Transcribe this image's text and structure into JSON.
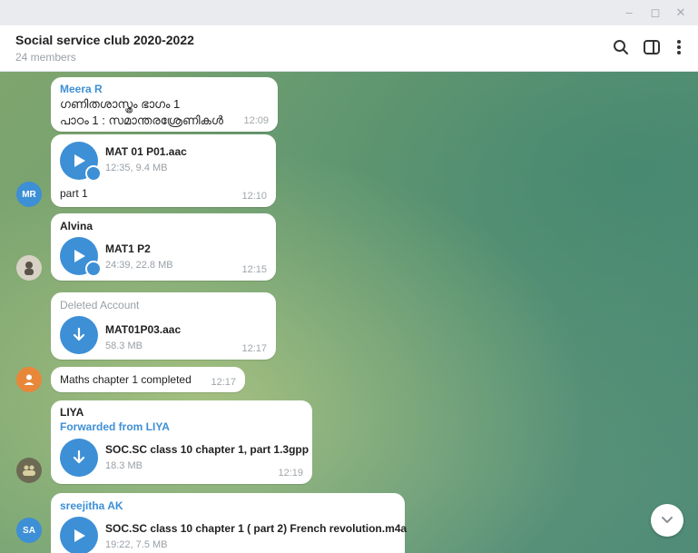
{
  "window": {
    "controls": [
      "–",
      "◻",
      "✕"
    ]
  },
  "header": {
    "title": "Social service club 2020-2022",
    "subtitle": "24 members",
    "icons": [
      "search-icon",
      "sidebar-toggle-icon",
      "more-vertical-icon"
    ]
  },
  "messages": [
    {
      "sender": "Meera R",
      "sender_color": "#3d8fd6",
      "text_line1": "ഗണിതശാസ്ത്രം ഭാഗം 1",
      "text_line2": "പാഠം 1 : സമാന്തരശ്രേണികൾ",
      "time": "12:09"
    },
    {
      "file_name": "MAT 01 P01.aac",
      "file_meta": "12:35, 9.4 MB",
      "caption": "part 1",
      "time": "12:10",
      "avatar_initials": "MR",
      "avatar_color": "#3d8fd6"
    },
    {
      "sender": "Alvina",
      "sender_color": "#222222",
      "file_name": "MAT1 P2",
      "file_meta": "24:39, 22.8 MB",
      "time": "12:15"
    },
    {
      "sender": "Deleted Account",
      "sender_color": "#9aa0a6",
      "file_name": "MAT01P03.aac",
      "file_meta": "58.3 MB",
      "time": "12:17"
    },
    {
      "text": "Maths chapter 1 completed",
      "time": "12:17",
      "avatar_color": "#e8873a"
    },
    {
      "sender": "LIYA",
      "sender_color": "#222222",
      "forwarded": "Forwarded from LIYA",
      "forwarded_color": "#3d8fd6",
      "file_name": "SOC.SC class 10 chapter 1, part 1.3gpp",
      "file_meta": "18.3 MB",
      "time": "12:19"
    },
    {
      "sender": "sreejitha AK",
      "sender_color": "#3d8fd6",
      "file_name": "SOC.SC class 10 chapter 1 ( part 2) French revolution.m4a",
      "file_meta": "19:22, 7.5 MB",
      "avatar_initials": "SA",
      "avatar_color": "#3d8fd6"
    }
  ],
  "colors": {
    "accent": "#3d8fd6",
    "bubble": "#ffffff"
  }
}
